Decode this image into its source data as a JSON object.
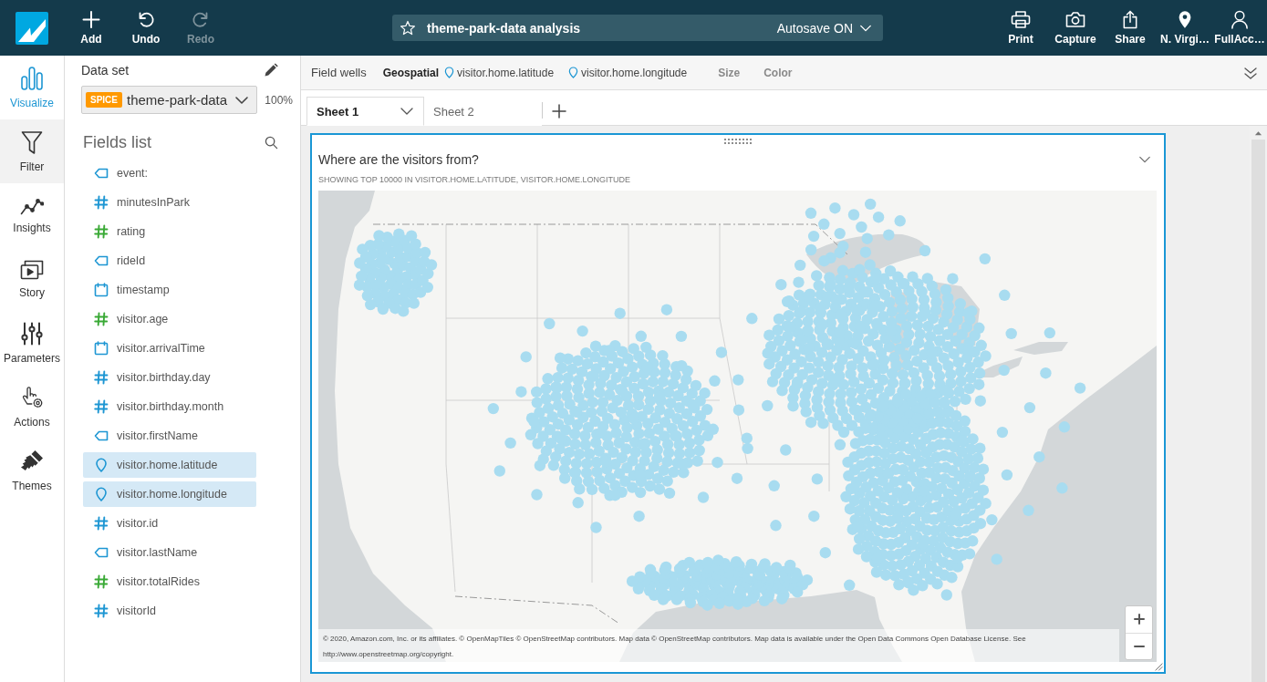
{
  "toolbar": {
    "buttons": [
      {
        "label": "Add",
        "disabled": false
      },
      {
        "label": "Undo",
        "disabled": false
      },
      {
        "label": "Redo",
        "disabled": true
      }
    ],
    "analysis_title": "theme-park-data analysis",
    "autosave": "Autosave ON",
    "actions": [
      {
        "label": "Print"
      },
      {
        "label": "Capture"
      },
      {
        "label": "Share"
      },
      {
        "label": "N. Virgi…"
      },
      {
        "label": "FullAcc…"
      }
    ]
  },
  "nav_rail": [
    {
      "label": "Visualize",
      "selected": true,
      "hovered": false
    },
    {
      "label": "Filter",
      "selected": false,
      "hovered": true
    },
    {
      "label": "Insights",
      "selected": false,
      "hovered": false
    },
    {
      "label": "Story",
      "selected": false,
      "hovered": false
    },
    {
      "label": "Parameters",
      "selected": false,
      "hovered": false
    },
    {
      "label": "Actions",
      "selected": false,
      "hovered": false
    },
    {
      "label": "Themes",
      "selected": false,
      "hovered": false
    }
  ],
  "data_set": {
    "label": "Data set",
    "badge": "SPICE",
    "name": "theme-park-data",
    "usage": "100%"
  },
  "fields_list": {
    "title": "Fields list",
    "fields": [
      {
        "name": "event:",
        "kind": "string",
        "selected": false
      },
      {
        "name": "minutesInPark",
        "kind": "number",
        "selected": false
      },
      {
        "name": "rating",
        "kind": "measure",
        "selected": false
      },
      {
        "name": "rideId",
        "kind": "string",
        "selected": false
      },
      {
        "name": "timestamp",
        "kind": "date",
        "selected": false
      },
      {
        "name": "visitor.age",
        "kind": "measure",
        "selected": false
      },
      {
        "name": "visitor.arrivalTime",
        "kind": "date",
        "selected": false
      },
      {
        "name": "visitor.birthday.day",
        "kind": "number",
        "selected": false
      },
      {
        "name": "visitor.birthday.month",
        "kind": "number",
        "selected": false
      },
      {
        "name": "visitor.firstName",
        "kind": "string",
        "selected": false
      },
      {
        "name": "visitor.home.latitude",
        "kind": "geo",
        "selected": true
      },
      {
        "name": "visitor.home.longitude",
        "kind": "geo",
        "selected": true
      },
      {
        "name": "visitor.id",
        "kind": "number",
        "selected": false
      },
      {
        "name": "visitor.lastName",
        "kind": "string",
        "selected": false
      },
      {
        "name": "visitor.totalRides",
        "kind": "measure",
        "selected": false
      },
      {
        "name": "visitorId",
        "kind": "number",
        "selected": false
      }
    ]
  },
  "field_wells": {
    "label": "Field wells",
    "geospatial": {
      "label": "Geospatial",
      "fields": [
        "visitor.home.latitude",
        "visitor.home.longitude"
      ]
    },
    "wells": [
      "Size",
      "Color"
    ]
  },
  "sheets": [
    {
      "label": "Sheet 1",
      "selected": true
    },
    {
      "label": "Sheet 2",
      "selected": false
    }
  ],
  "visual": {
    "title": "Where are the visitors from?",
    "subtitle": "SHOWING TOP 10000 IN VISITOR.HOME.LATITUDE, VISITOR.HOME.LONGITUDE",
    "attribution": "© 2020, Amazon.com, Inc. or its affiliates. © OpenMapTiles © OpenStreetMap contributors. Map data © OpenStreetMap contributors. Map data is available under the Open Data Commons Open Database License. See",
    "copyright_link": "http://www.openstreetmap.org/copyright."
  }
}
